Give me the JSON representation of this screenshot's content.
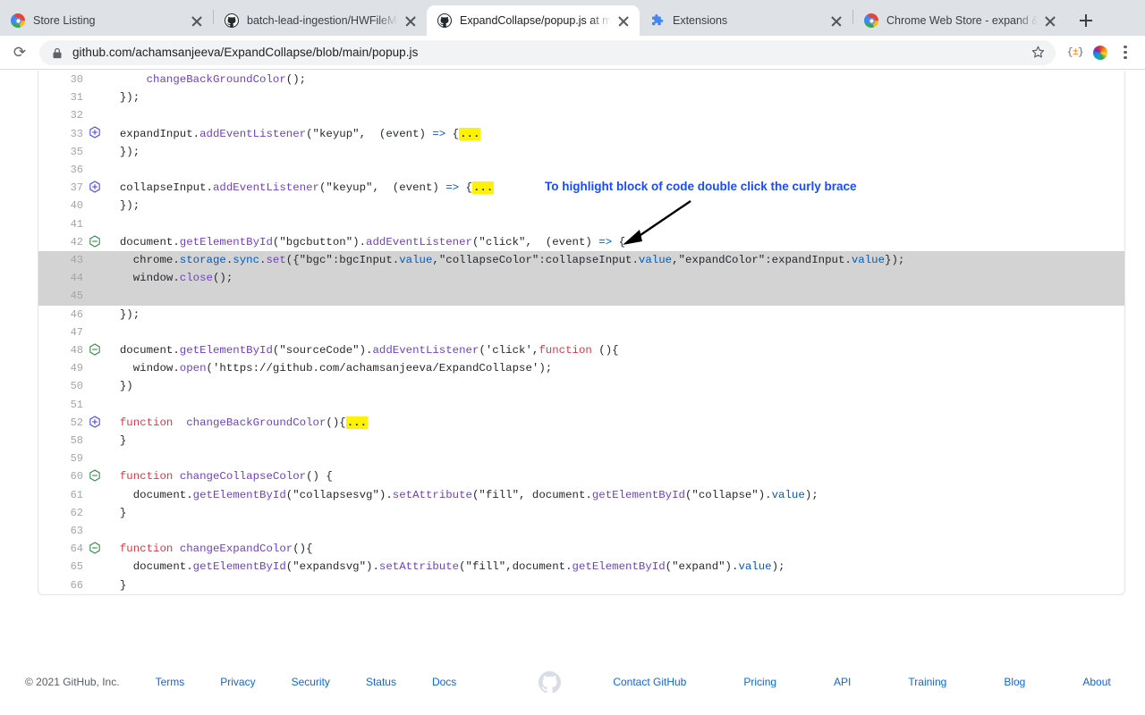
{
  "browser": {
    "tabs": [
      {
        "title": "Store Listing",
        "favicon": "chrome-icon",
        "active": false
      },
      {
        "title": "batch-lead-ingestion/HWFileM",
        "favicon": "github-icon",
        "active": false
      },
      {
        "title": "ExpandCollapse/popup.js at m",
        "favicon": "github-icon",
        "active": true
      },
      {
        "title": "Extensions",
        "favicon": "puzzle-icon",
        "active": false
      },
      {
        "title": "Chrome Web Store - expand &",
        "favicon": "chrome-icon",
        "active": false
      }
    ],
    "new_tab_label": "+",
    "toolbar": {
      "reload_glyph": "⟳",
      "url": "github.com/achamsanjeeva/ExpandCollapse/blob/main/popup.js",
      "lock_label": "Secure",
      "star_glyph": "☆",
      "extension_braces": "{+}",
      "menu_label": "Customize and control Google Chrome"
    }
  },
  "annotation": {
    "text": "To highlight  block of code double click the curly brace",
    "color": "#1a4cff"
  },
  "code": {
    "highlight_color": "#d3d3d3",
    "fold_dots": "...",
    "lines": [
      {
        "n": "30",
        "fold": "",
        "hl": false,
        "tokens": [
          {
            "t": "      changeBackGroundColor",
            "c": "def"
          },
          {
            "t": "();",
            "c": "plain"
          }
        ]
      },
      {
        "n": "31",
        "fold": "",
        "hl": false,
        "tokens": [
          {
            "t": "  });",
            "c": "plain"
          }
        ]
      },
      {
        "n": "32",
        "fold": "",
        "hl": false,
        "tokens": []
      },
      {
        "n": "33",
        "fold": "plus",
        "hl": false,
        "tokens": [
          {
            "t": "  expandInput.",
            "c": "plain"
          },
          {
            "t": "addEventListener",
            "c": "def"
          },
          {
            "t": "(\"keyup\",  (event) ",
            "c": "plain"
          },
          {
            "t": "=>",
            "c": "blue"
          },
          {
            "t": " {",
            "c": "plain"
          },
          {
            "t": "...",
            "c": "dots"
          }
        ]
      },
      {
        "n": "35",
        "fold": "",
        "hl": false,
        "tokens": [
          {
            "t": "  });",
            "c": "plain"
          }
        ]
      },
      {
        "n": "36",
        "fold": "",
        "hl": false,
        "tokens": []
      },
      {
        "n": "37",
        "fold": "plus",
        "hl": false,
        "tokens": [
          {
            "t": "  collapseInput.",
            "c": "plain"
          },
          {
            "t": "addEventListener",
            "c": "def"
          },
          {
            "t": "(\"keyup\",  (event) ",
            "c": "plain"
          },
          {
            "t": "=>",
            "c": "blue"
          },
          {
            "t": " {",
            "c": "plain"
          },
          {
            "t": "...",
            "c": "dots"
          }
        ]
      },
      {
        "n": "40",
        "fold": "",
        "hl": false,
        "tokens": [
          {
            "t": "  });",
            "c": "plain"
          }
        ]
      },
      {
        "n": "41",
        "fold": "",
        "hl": false,
        "tokens": []
      },
      {
        "n": "42",
        "fold": "minus",
        "hl": false,
        "tokens": [
          {
            "t": "  document.",
            "c": "plain"
          },
          {
            "t": "getElementById",
            "c": "def"
          },
          {
            "t": "(\"bgcbutton\").",
            "c": "plain"
          },
          {
            "t": "addEventListener",
            "c": "def"
          },
          {
            "t": "(\"click\",  (event) ",
            "c": "plain"
          },
          {
            "t": "=>",
            "c": "blue"
          },
          {
            "t": " {",
            "c": "plain"
          }
        ]
      },
      {
        "n": "43",
        "fold": "",
        "hl": true,
        "tokens": [
          {
            "t": "    chrome.",
            "c": "plain"
          },
          {
            "t": "storage",
            "c": "blue"
          },
          {
            "t": ".",
            "c": "plain"
          },
          {
            "t": "sync",
            "c": "blue"
          },
          {
            "t": ".",
            "c": "plain"
          },
          {
            "t": "set",
            "c": "def"
          },
          {
            "t": "({\"bgc\":bgcInput.",
            "c": "plain"
          },
          {
            "t": "value",
            "c": "blue"
          },
          {
            "t": ",\"collapseColor\":collapseInput.",
            "c": "plain"
          },
          {
            "t": "value",
            "c": "blue"
          },
          {
            "t": ",\"expandColor\":expandInput.",
            "c": "plain"
          },
          {
            "t": "value",
            "c": "blue"
          },
          {
            "t": "});",
            "c": "plain"
          }
        ]
      },
      {
        "n": "44",
        "fold": "",
        "hl": true,
        "tokens": [
          {
            "t": "    window.",
            "c": "plain"
          },
          {
            "t": "close",
            "c": "def"
          },
          {
            "t": "();",
            "c": "plain"
          }
        ]
      },
      {
        "n": "45",
        "fold": "",
        "hl": true,
        "tokens": []
      },
      {
        "n": "46",
        "fold": "",
        "hl": false,
        "tokens": [
          {
            "t": "  });",
            "c": "plain"
          }
        ]
      },
      {
        "n": "47",
        "fold": "",
        "hl": false,
        "tokens": []
      },
      {
        "n": "48",
        "fold": "minus",
        "hl": false,
        "tokens": [
          {
            "t": "  document.",
            "c": "plain"
          },
          {
            "t": "getElementById",
            "c": "def"
          },
          {
            "t": "(\"sourceCode\").",
            "c": "plain"
          },
          {
            "t": "addEventListener",
            "c": "def"
          },
          {
            "t": "('click',",
            "c": "plain"
          },
          {
            "t": "function",
            "c": "kw"
          },
          {
            "t": " (){",
            "c": "plain"
          }
        ]
      },
      {
        "n": "49",
        "fold": "",
        "hl": false,
        "tokens": [
          {
            "t": "    window.",
            "c": "plain"
          },
          {
            "t": "open",
            "c": "def"
          },
          {
            "t": "('https://github.com/achamsanjeeva/ExpandCollapse');",
            "c": "plain"
          }
        ]
      },
      {
        "n": "50",
        "fold": "",
        "hl": false,
        "tokens": [
          {
            "t": "  })",
            "c": "plain"
          }
        ]
      },
      {
        "n": "51",
        "fold": "",
        "hl": false,
        "tokens": []
      },
      {
        "n": "52",
        "fold": "plus",
        "hl": false,
        "tokens": [
          {
            "t": "  ",
            "c": "plain"
          },
          {
            "t": "function",
            "c": "kw"
          },
          {
            "t": "  ",
            "c": "plain"
          },
          {
            "t": "changeBackGroundColor",
            "c": "def"
          },
          {
            "t": "(){",
            "c": "plain"
          },
          {
            "t": "...",
            "c": "dots"
          }
        ]
      },
      {
        "n": "58",
        "fold": "",
        "hl": false,
        "tokens": [
          {
            "t": "  }",
            "c": "plain"
          }
        ]
      },
      {
        "n": "59",
        "fold": "",
        "hl": false,
        "tokens": []
      },
      {
        "n": "60",
        "fold": "minus",
        "hl": false,
        "tokens": [
          {
            "t": "  ",
            "c": "plain"
          },
          {
            "t": "function",
            "c": "kw"
          },
          {
            "t": " ",
            "c": "plain"
          },
          {
            "t": "changeCollapseColor",
            "c": "def"
          },
          {
            "t": "() {",
            "c": "plain"
          }
        ]
      },
      {
        "n": "61",
        "fold": "",
        "hl": false,
        "tokens": [
          {
            "t": "    document.",
            "c": "plain"
          },
          {
            "t": "getElementById",
            "c": "def"
          },
          {
            "t": "(\"collapsesvg\").",
            "c": "plain"
          },
          {
            "t": "setAttribute",
            "c": "def"
          },
          {
            "t": "(\"fill\", document.",
            "c": "plain"
          },
          {
            "t": "getElementById",
            "c": "def"
          },
          {
            "t": "(\"collapse\").",
            "c": "plain"
          },
          {
            "t": "value",
            "c": "blue"
          },
          {
            "t": ");",
            "c": "plain"
          }
        ]
      },
      {
        "n": "62",
        "fold": "",
        "hl": false,
        "tokens": [
          {
            "t": "  }",
            "c": "plain"
          }
        ]
      },
      {
        "n": "63",
        "fold": "",
        "hl": false,
        "tokens": []
      },
      {
        "n": "64",
        "fold": "minus",
        "hl": false,
        "tokens": [
          {
            "t": "  ",
            "c": "plain"
          },
          {
            "t": "function",
            "c": "kw"
          },
          {
            "t": " ",
            "c": "plain"
          },
          {
            "t": "changeExpandColor",
            "c": "def"
          },
          {
            "t": "(){",
            "c": "plain"
          }
        ]
      },
      {
        "n": "65",
        "fold": "",
        "hl": false,
        "tokens": [
          {
            "t": "    document.",
            "c": "plain"
          },
          {
            "t": "getElementById",
            "c": "def"
          },
          {
            "t": "(\"expandsvg\").",
            "c": "plain"
          },
          {
            "t": "setAttribute",
            "c": "def"
          },
          {
            "t": "(\"fill\",document.",
            "c": "plain"
          },
          {
            "t": "getElementById",
            "c": "def"
          },
          {
            "t": "(\"expand\").",
            "c": "plain"
          },
          {
            "t": "value",
            "c": "blue"
          },
          {
            "t": ");",
            "c": "plain"
          }
        ]
      },
      {
        "n": "66",
        "fold": "",
        "hl": false,
        "tokens": [
          {
            "t": "  }",
            "c": "plain"
          }
        ]
      }
    ]
  },
  "footer": {
    "copyright": "© 2021 GitHub, Inc.",
    "left_links": [
      "Terms",
      "Privacy",
      "Security",
      "Status",
      "Docs"
    ],
    "right_links": [
      "Contact GitHub",
      "Pricing",
      "API",
      "Training",
      "Blog",
      "About"
    ],
    "mark": "github-mark-icon"
  }
}
